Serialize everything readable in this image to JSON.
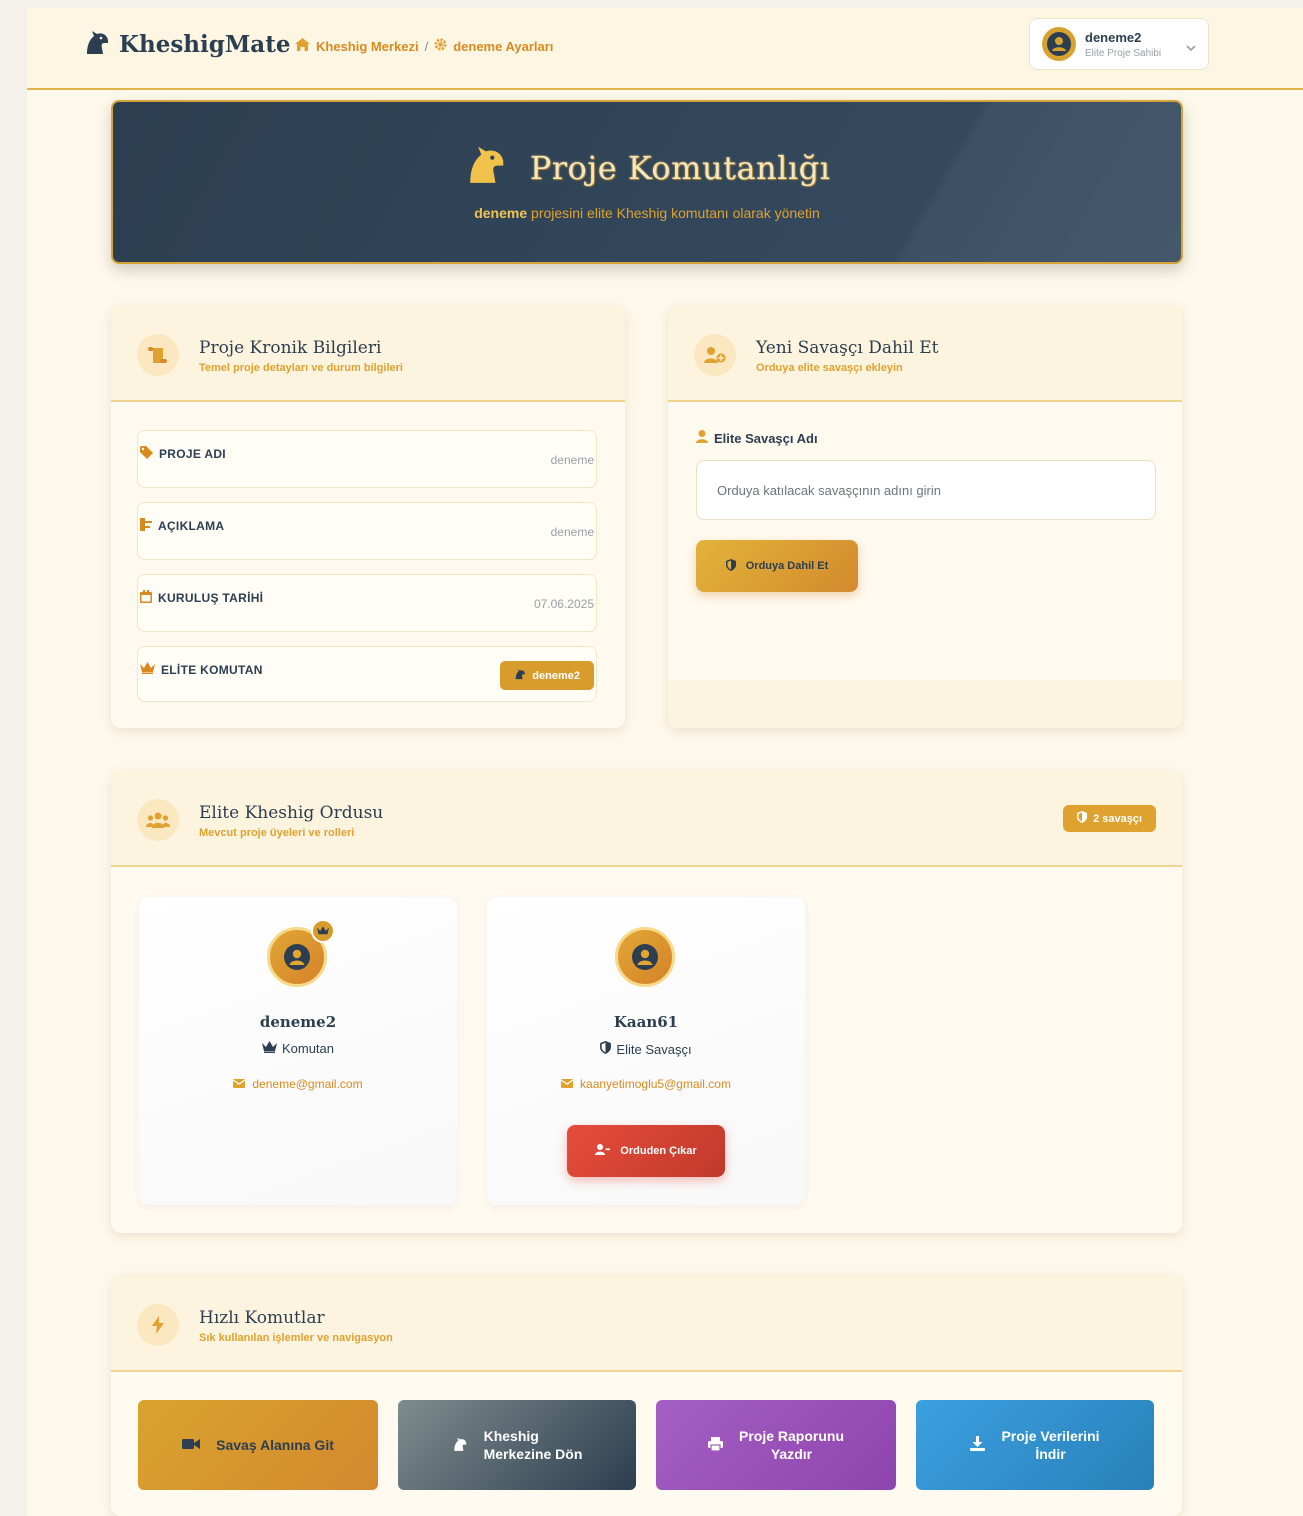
{
  "header": {
    "brand": "KheshigMate",
    "breadcrumbs": [
      "Kheshig Merkezi",
      "/",
      "deneme Ayarları"
    ],
    "user": {
      "name": "deneme2",
      "role": "Elite Proje Sahibi"
    }
  },
  "hero": {
    "title": "Proje Komutanlığı",
    "subtitle_project": "deneme",
    "subtitle_rest": " projesini elite Kheshig komutanı olarak yönetin"
  },
  "info_card": {
    "title": "Proje Kronik Bilgileri",
    "subtitle": "Temel proje detayları ve durum bilgileri",
    "rows": [
      {
        "label": "PROJE ADI",
        "value": "deneme"
      },
      {
        "label": "AÇIKLAMA",
        "value": "deneme"
      },
      {
        "label": "KURULUŞ TARİHİ",
        "value": "07.06.2025"
      },
      {
        "label": "ELİTE KOMUTAN",
        "value": "deneme2"
      }
    ]
  },
  "add_card": {
    "title": "Yeni Savaşçı Dahil Et",
    "subtitle": "Orduya elite savaşçı ekleyin",
    "field_label": "Elite Savaşçı Adı",
    "placeholder": "Orduya katılacak savaşçının adını girin",
    "button": "Orduya Dahil Et"
  },
  "army_card": {
    "title": "Elite Kheshig Ordusu",
    "subtitle": "Mevcut proje üyeleri ve rolleri",
    "count_badge": "2 savaşçı",
    "members": [
      {
        "name": "deneme2",
        "role": "Komutan",
        "email": "deneme@gmail.com"
      },
      {
        "name": "Kaan61",
        "role": "Elite Savaşçı",
        "email": "kaanyetimoglu5@gmail.com",
        "action": "Orduden Çıkar"
      }
    ]
  },
  "quick_card": {
    "title": "Hızlı Komutlar",
    "subtitle": "Sık kullanılan işlemler ve navigasyon",
    "buttons": [
      {
        "label": "Savaş Alanına Git",
        "color": "#d9a32f"
      },
      {
        "label_line1": "Kheshig",
        "label_line2": "Merkezine Dön",
        "color": "#5d6d7e"
      },
      {
        "label_line1": "Proje Raporunu",
        "label_line2": "Yazdır",
        "color": "#9b59b6"
      },
      {
        "label_line1": "Proje Verilerini",
        "label_line2": "İndir",
        "color": "#3498db"
      }
    ]
  },
  "colors": {
    "accent": "#e0a22f",
    "navy": "#2c3e50",
    "danger": "#e74c3c"
  }
}
